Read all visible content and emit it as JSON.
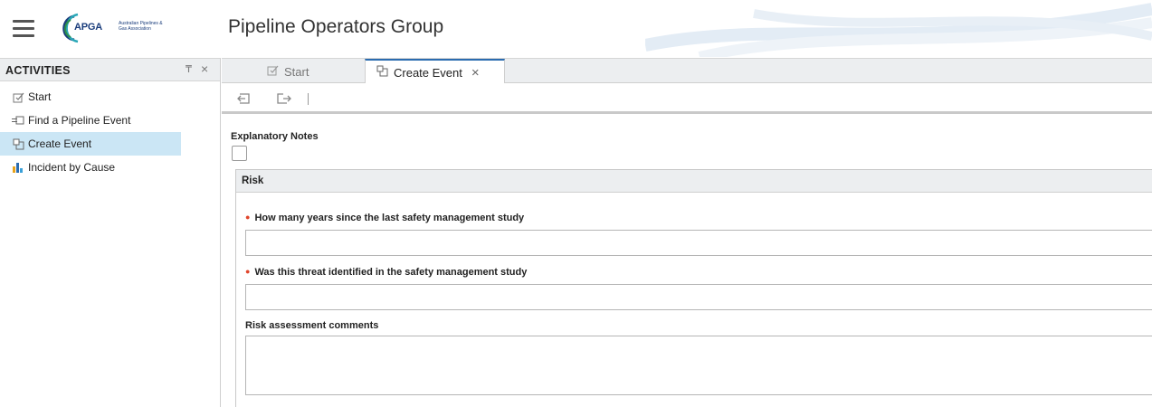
{
  "header": {
    "logo_text": "APGA",
    "logo_subtitle": "Australian Pipelines & Gas Association",
    "title": "Pipeline Operators Group",
    "brand_color": "#1a3d7c"
  },
  "left_panel": {
    "title": "ACTIVITIES",
    "items": [
      {
        "label": "Start",
        "icon": "checkbox-pen-icon"
      },
      {
        "label": "Find a Pipeline Event",
        "icon": "find-icon"
      },
      {
        "label": "Create Event",
        "icon": "create-event-icon",
        "active": true
      },
      {
        "label": "Incident by Cause",
        "icon": "chart-icon"
      }
    ]
  },
  "tabs": [
    {
      "label": "Start",
      "active": false
    },
    {
      "label": "Create Event",
      "active": true
    }
  ],
  "form": {
    "explanatory_label": "Explanatory Notes",
    "explanatory_checked": false,
    "section_title": "Risk",
    "fields": [
      {
        "label": "How many years since the last safety management study",
        "required": true,
        "value": ""
      },
      {
        "label": "Was this threat identified in the safety management study",
        "required": true,
        "value": ""
      },
      {
        "label": "Risk assessment comments",
        "required": false,
        "value": ""
      }
    ]
  },
  "colors": {
    "active_item": "#cbe6f5",
    "tab_accent": "#2b6cb0",
    "required_dot": "#e0452b"
  }
}
